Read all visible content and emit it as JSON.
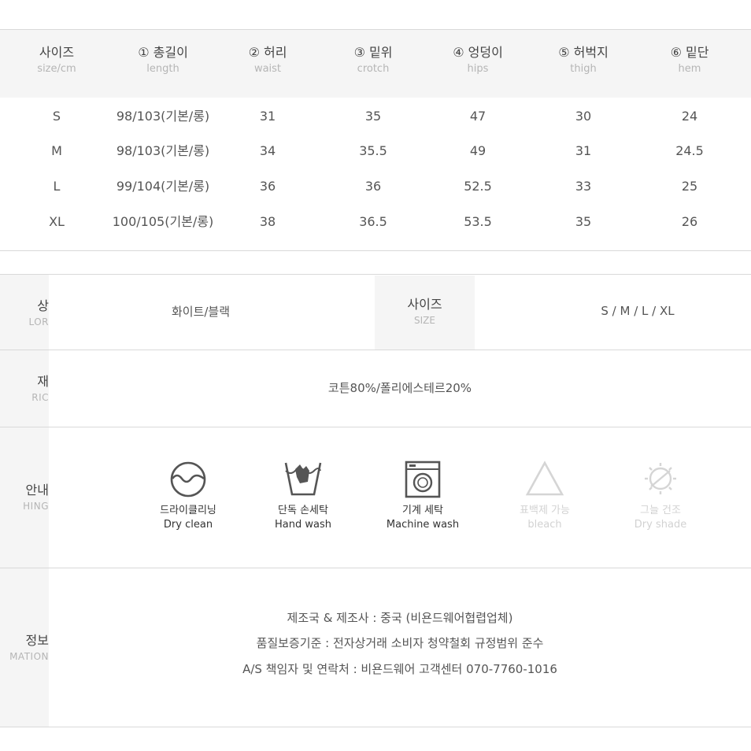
{
  "size_table": {
    "headers": [
      {
        "ko": "사이즈",
        "en": "size/cm"
      },
      {
        "ko": "① 총길이",
        "en": "length"
      },
      {
        "ko": "② 허리",
        "en": "waist"
      },
      {
        "ko": "③ 밑위",
        "en": "crotch"
      },
      {
        "ko": "④ 엉덩이",
        "en": "hips"
      },
      {
        "ko": "⑤ 허벅지",
        "en": "thigh"
      },
      {
        "ko": "⑥ 밑단",
        "en": "hem"
      }
    ],
    "rows": [
      [
        "S",
        "98/103(기본/롱)",
        "31",
        "35",
        "47",
        "30",
        "24"
      ],
      [
        "M",
        "98/103(기본/롱)",
        "34",
        "35.5",
        "49",
        "31",
        "24.5"
      ],
      [
        "L",
        "99/104(기본/롱)",
        "36",
        "36",
        "52.5",
        "33",
        "25"
      ],
      [
        "XL",
        "100/105(기본/롱)",
        "38",
        "36.5",
        "53.5",
        "35",
        "26"
      ]
    ]
  },
  "info": {
    "color_label_ko": "상",
    "color_label_en": "LOR",
    "color_value": "화이트/블랙",
    "size_label_ko": "사이즈",
    "size_label_en": "SIZE",
    "size_value": "S / M / L / XL",
    "fabric_label_ko": "재",
    "fabric_label_en": "RIC",
    "fabric_value": "코튼80%/폴리에스테르20%",
    "washing_label_ko": "안내",
    "washing_label_en": "HING",
    "care_items": [
      {
        "icon": "dry-clean-icon",
        "ko": "드라이클리닝",
        "en": "Dry clean"
      },
      {
        "icon": "hand-wash-icon",
        "ko": "단독 손세탁",
        "en": "Hand wash"
      },
      {
        "icon": "machine-wash-icon",
        "ko": "기계 세탁",
        "en": "Machine wash"
      },
      {
        "icon": "bleach-icon",
        "ko": "표백제 가능",
        "en": "bleach"
      },
      {
        "icon": "dry-shade-icon",
        "ko": "그늘 건조",
        "en": "Dry shade"
      }
    ],
    "product_label_ko": "정보",
    "product_label_en": "MATION",
    "product_lines": [
      "제조국 & 제조사 : 중국 (비욘드웨어협렵업체)",
      "품질보증기준 : 전자상거래 소비자 청약철회 규정범위 준수",
      "A/S 책임자 및 연락처 : 비욘드웨어 고객센터 070-7760-1016"
    ]
  },
  "colors": {
    "header_bg": "#f5f5f5",
    "line": "#d9d9d9",
    "icon_active": "#555555",
    "icon_dim": "#d5d5d5"
  }
}
